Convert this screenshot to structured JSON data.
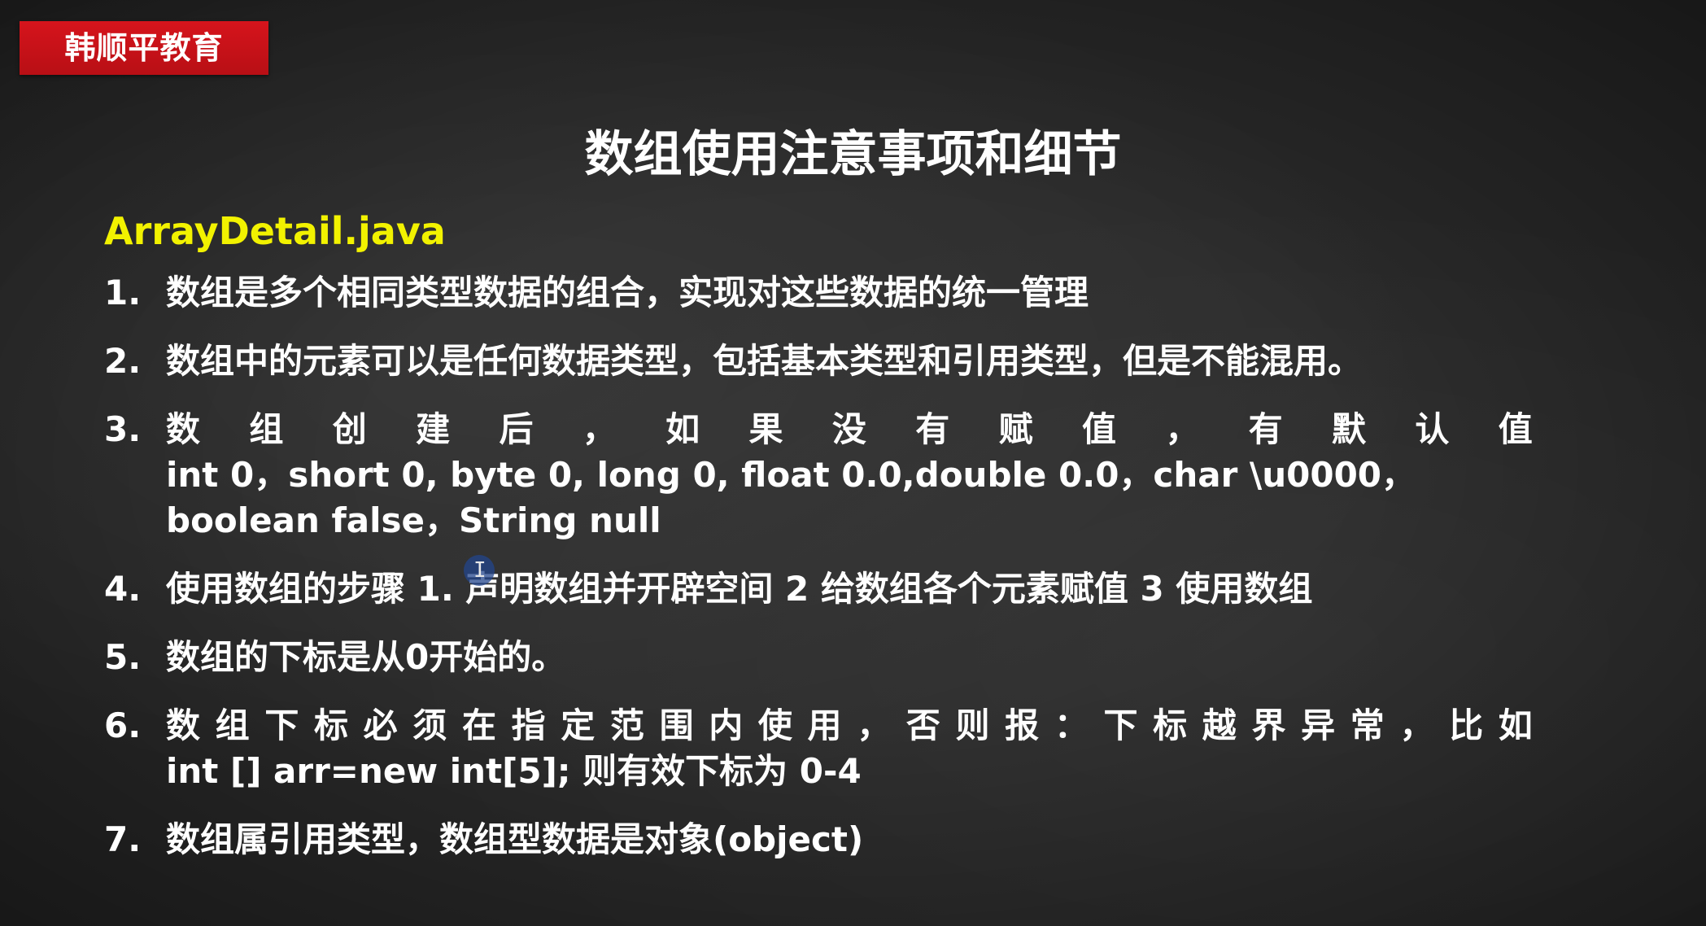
{
  "brand": {
    "label": "韩顺平教育"
  },
  "title": "数组使用注意事项和细节",
  "filename": "ArrayDetail.java",
  "points": [
    {
      "num": "1.",
      "lines": [
        "数组是多个相同类型数据的组合，实现对这些数据的统一管理"
      ]
    },
    {
      "num": "2.",
      "lines": [
        "数组中的元素可以是任何数据类型，包括基本类型和引用类型，但是不能混用。"
      ]
    },
    {
      "num": "3.",
      "spaced_chars": [
        "数",
        "组",
        "创",
        "建",
        "后",
        "，",
        "如",
        "果",
        "没",
        "有",
        "赋",
        "值",
        "，",
        "有",
        "默",
        "认",
        "值"
      ],
      "lines": [
        "int 0，short 0, byte 0, long 0, float 0.0,double 0.0，char \\u0000，",
        "boolean false，String null"
      ]
    },
    {
      "num": "4.",
      "lines": [
        "使用数组的步骤 1. 声明数组并开辟空间 2 给数组各个元素赋值 3 使用数组"
      ]
    },
    {
      "num": "5.",
      "lines": [
        "数组的下标是从0开始的。"
      ]
    },
    {
      "num": "6.",
      "spaced_chars": [
        "数",
        "组",
        "下",
        "标",
        "必",
        "须",
        "在",
        "指",
        "定",
        "范",
        "围",
        "内",
        "使",
        "用",
        "，",
        "否",
        "则",
        "报",
        "：",
        "下",
        "标",
        "越",
        "界",
        "异",
        "常",
        "，",
        "比",
        "如"
      ],
      "lines": [
        "int [] arr=new int[5]; 则有效下标为 0-4"
      ]
    },
    {
      "num": "7.",
      "lines": [
        "数组属引用类型，数组型数据是对象(object)"
      ]
    }
  ],
  "colors": {
    "background": "#2b2b2b",
    "brand_red": "#d6141c",
    "filename_yellow": "#f2f200",
    "text": "#ffffff"
  },
  "cursor": {
    "icon": "text-cursor-icon",
    "glyph": "I"
  }
}
